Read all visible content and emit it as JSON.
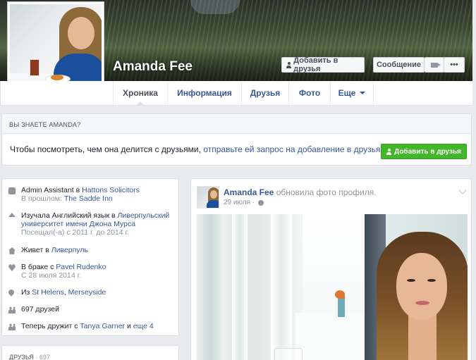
{
  "profile": {
    "name": "Amanda Fee"
  },
  "cover_actions": {
    "add_friend": "Добавить в друзья",
    "message": "Сообщение",
    "more": "•••"
  },
  "tabs": [
    {
      "label": "Хроника",
      "active": true
    },
    {
      "label": "Информация"
    },
    {
      "label": "Друзья"
    },
    {
      "label": "Фото"
    },
    {
      "label": "Еще"
    }
  ],
  "know_box": {
    "header": "ВЫ ЗНАЕТЕ AMANDA?",
    "text": "Чтобы посмотреть, чем она делится с друзьями,",
    "link": "отправьте ей запрос на добавление в друзья.",
    "button": "Добавить в друзья"
  },
  "intro": {
    "work": {
      "title": "Admin Assistant в",
      "company": "Hattons Solicitors",
      "past_label": "В прошлом:",
      "past_company": "The Sadde Inn"
    },
    "education": {
      "text": "Изучала Английский язык в",
      "school": "Ливерпульский университет имени Джона Мурса",
      "dates": "Посещал(-а) с 2011 г. до 2014 г."
    },
    "lives": {
      "text": "Живет в",
      "city": "Ливерпуль"
    },
    "relationship": {
      "text": "В браке с",
      "partner": "Pavel Rudenko",
      "since": "С 28 июля 2014 г."
    },
    "from": {
      "text": "Из",
      "city": "St Helens",
      "region": "Merseyside"
    },
    "friends": {
      "text": "697 друзей"
    },
    "recent_friends": {
      "text": "Теперь дружит с",
      "friend": "Tanya Garner",
      "and": "и",
      "more": "еще 4"
    }
  },
  "friends_card": {
    "label": "ДРУЗЬЯ",
    "count": "· 697"
  },
  "post": {
    "author": "Amanda Fee",
    "action": "обновила фото профиля.",
    "date": "29 июля ·"
  },
  "colors": {
    "link": "#365899",
    "green_button": "#42b72a",
    "background": "#e9ebee"
  }
}
